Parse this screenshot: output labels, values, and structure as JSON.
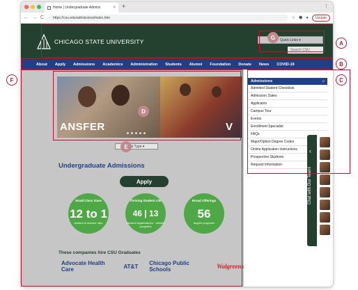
{
  "browser": {
    "tab_title": "Home | Undergraduate Admiss",
    "tab_close": "×",
    "new_tab": "+",
    "url": "https://csu.edu/admissions/index.htm",
    "update_label": "Update",
    "nav_back": "←",
    "nav_forward": "→",
    "reload": "C",
    "window_menu": "⋮"
  },
  "header": {
    "logo_text": "CHICAGO STATE UNIVERSITY",
    "quick_links": "Quick Links",
    "search_placeholder": "Search CSU"
  },
  "main_nav": [
    "About",
    "Apply",
    "Admissions",
    "Academics",
    "Administration",
    "Students",
    "Alumni",
    "Foundation",
    "Donate",
    "News",
    "COVID-19"
  ],
  "hero": {
    "text_left": "ANSFER",
    "text_right": "V"
  },
  "student_type": "Student Type",
  "content": {
    "title": "Undergraduate Admissions",
    "apply_button": "Apply",
    "stats": [
      {
        "label": "Small Class Sizes",
        "value": "12 to 1",
        "sub": "student to teacher ratio"
      },
      {
        "label": "Thriving Student Life",
        "value": "46 | 13",
        "sub": "student organizations · athletic programs"
      },
      {
        "label": "Broad Offerings",
        "value": "56",
        "sub": "degree programs"
      }
    ],
    "hire_title": "These companies hire CSU Graduates",
    "companies": [
      "Advocate Health Care",
      "AT&T",
      "Chicago Public Schools",
      "Walgreens"
    ]
  },
  "sidebar": {
    "title": "Admissions",
    "items": [
      "Admitted Student Checklists",
      "Admission Dates",
      "Applicants",
      "Campus Tour",
      "Events",
      "Enrollment Specialist",
      "FAQs",
      "Major/Option Degree Codes",
      "Online Application Instructions",
      "Prospective Students",
      "Request Information"
    ]
  },
  "chat": {
    "label": "Chat with Our Team!"
  },
  "annotations": [
    "A",
    "B",
    "C",
    "D",
    "E",
    "F",
    "G"
  ],
  "colors": {
    "header_green": "#24402e",
    "nav_blue": "#1f3f86",
    "annotation_red": "#c8102e"
  }
}
